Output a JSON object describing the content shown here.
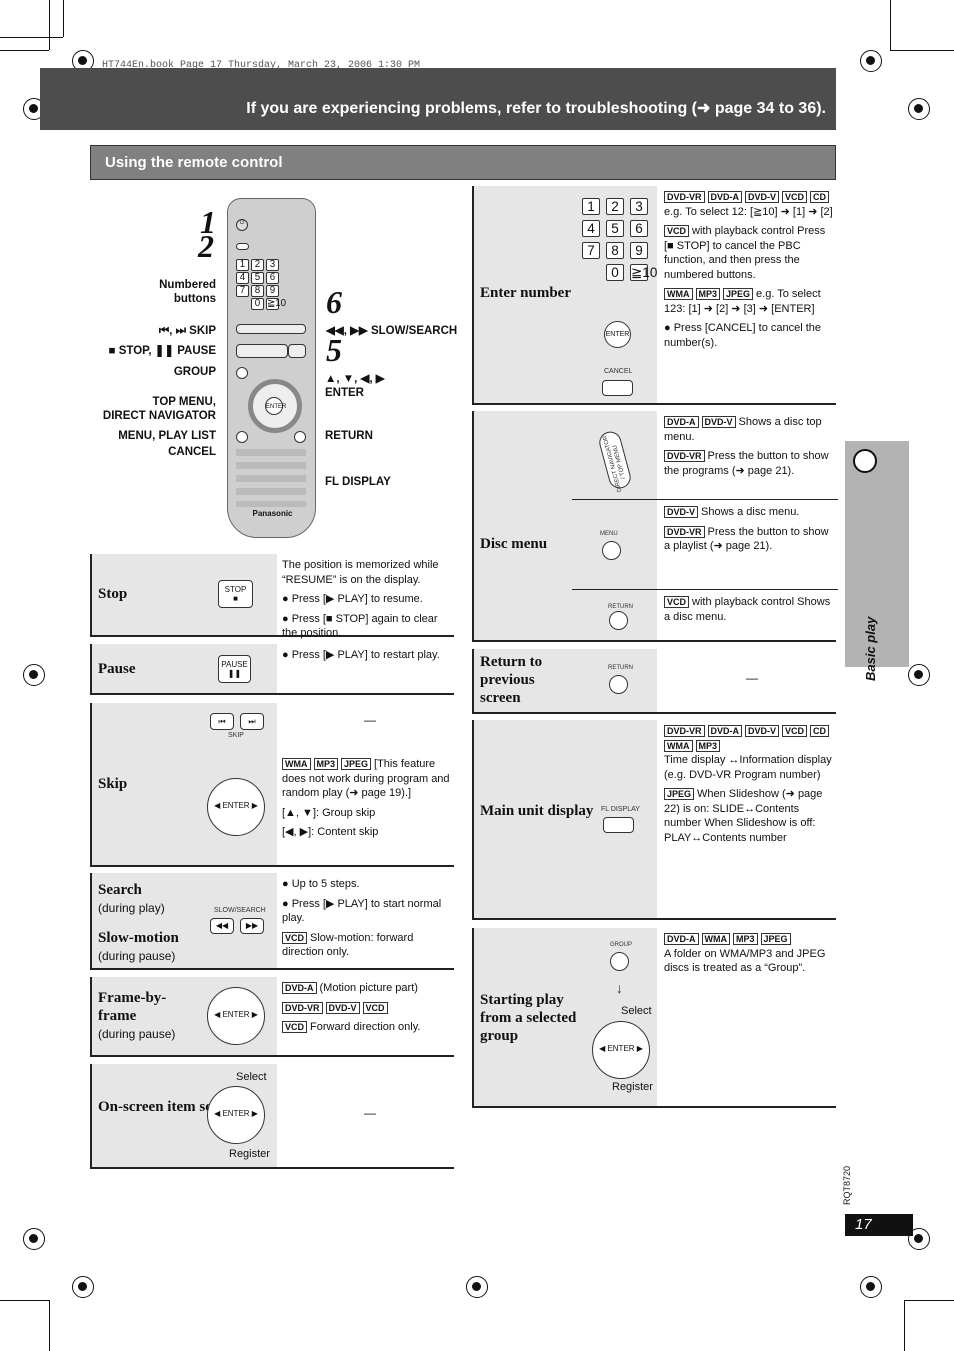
{
  "book_line": "HT744En.book  Page 17  Thursday, March 23, 2006  1:30 PM",
  "header": {
    "title": "If you are experiencing problems, refer to troubleshooting (➜ page 34 to 36)."
  },
  "section": {
    "title": "Using the remote control"
  },
  "remote": {
    "brand": "Panasonic",
    "steps": [
      "1",
      "2",
      "5",
      "6"
    ],
    "labels": {
      "numbered": "Numbered buttons",
      "skip": "⏮, ⏭  SKIP",
      "stop_pause": "■ STOP, ❚❚ PAUSE",
      "group": "GROUP",
      "top_menu": "TOP MENU,",
      "direct_nav": "DIRECT NAVIGATOR",
      "menu": "MENU, PLAY LIST",
      "cancel": "CANCEL",
      "slow": "◀◀, ▶▶ SLOW/SEARCH",
      "arrows": "▲, ▼, ◀, ▶",
      "enter": "ENTER",
      "return": "RETURN",
      "fl": "FL DISPLAY"
    },
    "keys": [
      "1",
      "2",
      "3",
      "4",
      "5",
      "6",
      "7",
      "8",
      "9",
      "0",
      "≧10"
    ]
  },
  "left_rows": [
    {
      "label": "Stop",
      "button": "STOP",
      "blocks": [
        {
          "text": "The position is memorized while “RESUME” is on the display."
        },
        {
          "text": "● Press [▶ PLAY] to resume."
        },
        {
          "text": "● Press [■ STOP] again to clear the position."
        }
      ]
    },
    {
      "label": "Pause",
      "button": "PAUSE",
      "blocks": [
        {
          "text": "● Press [▶ PLAY] to restart play."
        }
      ]
    },
    {
      "label": "Skip",
      "button": "SKIP",
      "dash": "—",
      "blocks": [
        {
          "tags": [
            "WMA",
            "MP3",
            "JPEG"
          ],
          "text": "[This feature does not work during program and random play (➜ page 19).]"
        },
        {
          "text": "[▲, ▼]:  Group skip"
        },
        {
          "text": "[◀, ▶]:  Content skip"
        }
      ]
    },
    {
      "label": "Search",
      "sub": "(during play)",
      "label2": "Slow-motion",
      "sub2": "(during pause)",
      "button": "SLOW/SEARCH",
      "blocks": [
        {
          "text": "● Up to 5 steps."
        },
        {
          "text": "● Press [▶ PLAY] to start normal play."
        },
        {
          "tags": [
            "VCD"
          ],
          "text": "Slow-motion: forward direction only."
        }
      ]
    },
    {
      "label": "Frame-by-frame",
      "sub": "(during pause)",
      "blocks": [
        {
          "tags": [
            "DVD-A"
          ],
          "text": "(Motion picture part)"
        },
        {
          "tags": [
            "DVD-VR",
            "DVD-V",
            "VCD"
          ],
          "text": ""
        },
        {
          "tags": [
            "VCD"
          ],
          "text": "Forward direction only."
        }
      ]
    },
    {
      "label": "On-screen item select",
      "select": "Select",
      "register": "Register",
      "dash": "—",
      "blocks": []
    }
  ],
  "right_rows": [
    {
      "label": "Enter number",
      "enter": "ENTER",
      "cancel": "CANCEL",
      "blocks": [
        {
          "tags": [
            "DVD-VR",
            "DVD-A",
            "DVD-V",
            "VCD",
            "CD"
          ],
          "text": "e.g. To select 12: [≧10] ➜ [1] ➜ [2]"
        },
        {
          "tags": [
            "VCD"
          ],
          "text": "with playback control Press [■ STOP] to cancel the PBC function, and then press the numbered buttons."
        },
        {
          "tags": [
            "WMA",
            "MP3",
            "JPEG"
          ],
          "text": "e.g. To select 123: [1] ➜ [2] ➜ [3] ➜ [ENTER]"
        },
        {
          "text": "● Press [CANCEL] to cancel the number(s)."
        }
      ]
    },
    {
      "label": "Disc menu",
      "button1": "DIRECT NAVIGATOR / TOP MENU",
      "button2": "MENU / PLAY LIST",
      "button3": "RETURN",
      "blocks1": [
        {
          "tags": [
            "DVD-A",
            "DVD-V"
          ],
          "text": "Shows a disc top menu."
        },
        {
          "tags": [
            "DVD-VR"
          ],
          "text": "Press the button to show the programs (➜ page 21)."
        }
      ],
      "blocks2": [
        {
          "tags": [
            "DVD-V"
          ],
          "text": "Shows a disc menu."
        },
        {
          "tags": [
            "DVD-VR"
          ],
          "text": "Press the button to show a playlist (➜ page 21)."
        }
      ],
      "blocks3": [
        {
          "tags": [
            "VCD"
          ],
          "text": "with playback control Shows a disc menu."
        }
      ]
    },
    {
      "label": "Return to previous screen",
      "button": "RETURN",
      "dash": "—"
    },
    {
      "label": "Main unit display",
      "button": "FL DISPLAY",
      "blocks": [
        {
          "tags": [
            "DVD-VR",
            "DVD-A",
            "DVD-V",
            "VCD",
            "CD",
            "WMA",
            "MP3"
          ],
          "text": "Time display ↔Information display (e.g. DVD-VR Program number)"
        },
        {
          "tags": [
            "JPEG"
          ],
          "text": "When Slideshow (➜ page 22) is on: SLIDE↔Contents number When Slideshow is off: PLAY↔Contents number"
        }
      ]
    },
    {
      "label": "Starting play from a selected group",
      "button": "GROUP",
      "select": "Select",
      "register": "Register",
      "blocks": [
        {
          "tags": [
            "DVD-A",
            "WMA",
            "MP3",
            "JPEG"
          ],
          "text": "A folder on WMA/MP3 and JPEG discs is treated as a “Group”."
        }
      ]
    }
  ],
  "sidebar": {
    "title": "Basic play",
    "icon": "disc-icon"
  },
  "doc_code": "RQT8720",
  "page_number": "17"
}
